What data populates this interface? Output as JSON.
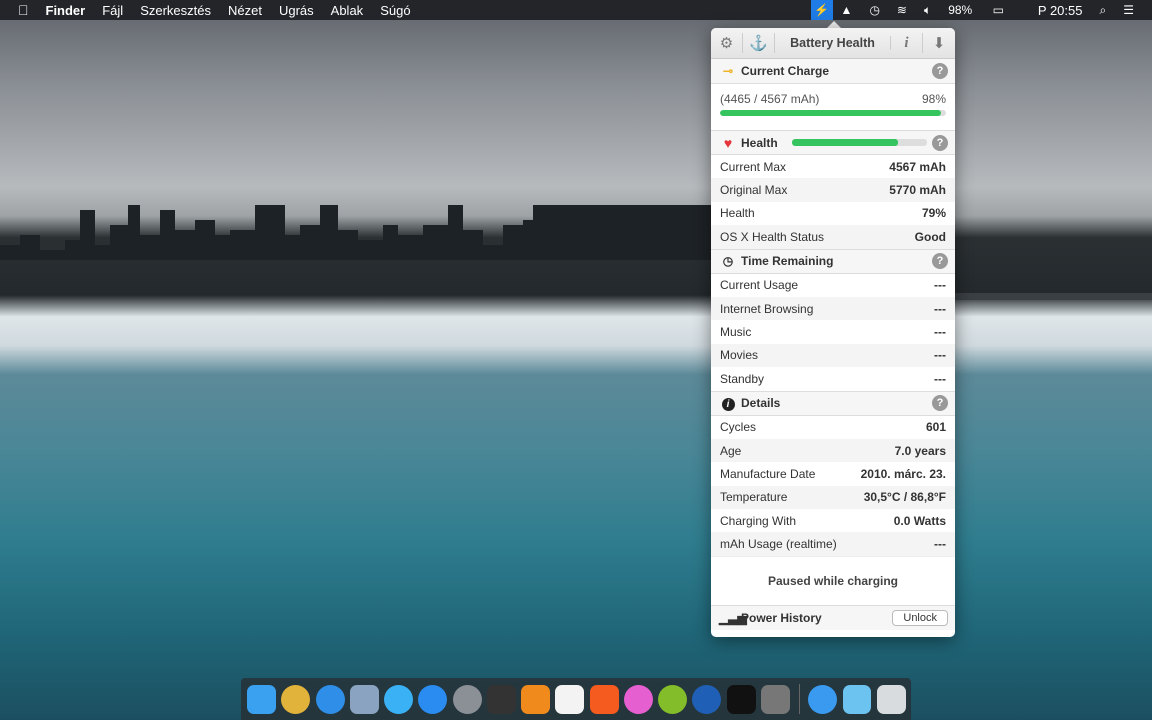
{
  "menubar": {
    "app": "Finder",
    "items": [
      "Fájl",
      "Szerkesztés",
      "Nézet",
      "Ugrás",
      "Ablak",
      "Súgó"
    ],
    "battery": "98%",
    "clock": "P 20:55"
  },
  "popup": {
    "title": "Battery Health",
    "current_charge": {
      "label": "Current Charge",
      "detail": "(4465 / 4567 mAh)",
      "percent": "98%",
      "fill": 98
    },
    "health": {
      "label": "Health",
      "fill": 79,
      "rows": [
        {
          "label": "Current Max",
          "value": "4567 mAh"
        },
        {
          "label": "Original Max",
          "value": "5770 mAh"
        },
        {
          "label": "Health",
          "value": "79%"
        },
        {
          "label": "OS X Health Status",
          "value": "Good"
        }
      ]
    },
    "time_remaining": {
      "label": "Time Remaining",
      "rows": [
        {
          "label": "Current Usage",
          "value": "---"
        },
        {
          "label": "Internet Browsing",
          "value": "---"
        },
        {
          "label": "Music",
          "value": "---"
        },
        {
          "label": "Movies",
          "value": "---"
        },
        {
          "label": "Standby",
          "value": "---"
        }
      ]
    },
    "details": {
      "label": "Details",
      "rows": [
        {
          "label": "Cycles",
          "value": "601"
        },
        {
          "label": "Age",
          "value": "7.0 years"
        },
        {
          "label": "Manufacture Date",
          "value": "2010. márc. 23."
        },
        {
          "label": "Temperature",
          "value": "30,5°C / 86,8°F"
        },
        {
          "label": "Charging With",
          "value": "0.0 Watts"
        },
        {
          "label": "mAh Usage (realtime)",
          "value": "---"
        }
      ]
    },
    "paused": "Paused while charging",
    "power_history": "Power History",
    "unlock": "Unlock"
  },
  "dock": [
    {
      "name": "finder",
      "color": "#3aa0f0"
    },
    {
      "name": "chrome",
      "color": "#e2b33a"
    },
    {
      "name": "safari",
      "color": "#2f8ee8"
    },
    {
      "name": "preview",
      "color": "#8aa3c0"
    },
    {
      "name": "messages",
      "color": "#3ab0f5"
    },
    {
      "name": "app-store",
      "color": "#2a8cf0"
    },
    {
      "name": "launchpad",
      "color": "#8b8f96"
    },
    {
      "name": "mission-control",
      "color": "#333"
    },
    {
      "name": "vlc",
      "color": "#f08a1c"
    },
    {
      "name": "calendar",
      "color": "#f3f3f3"
    },
    {
      "name": "soundcloud",
      "color": "#f55a1f"
    },
    {
      "name": "itunes",
      "color": "#e55fd0"
    },
    {
      "name": "spotify",
      "color": "#84bd2a"
    },
    {
      "name": "winbox",
      "color": "#1f5fb5"
    },
    {
      "name": "terminal",
      "color": "#111"
    },
    {
      "name": "system-preferences",
      "color": "#777"
    },
    {
      "name": "applications-folder",
      "color": "#3a9af0"
    },
    {
      "name": "documents-folder",
      "color": "#6cc3f0"
    },
    {
      "name": "trash",
      "color": "#d8dcdf"
    }
  ]
}
